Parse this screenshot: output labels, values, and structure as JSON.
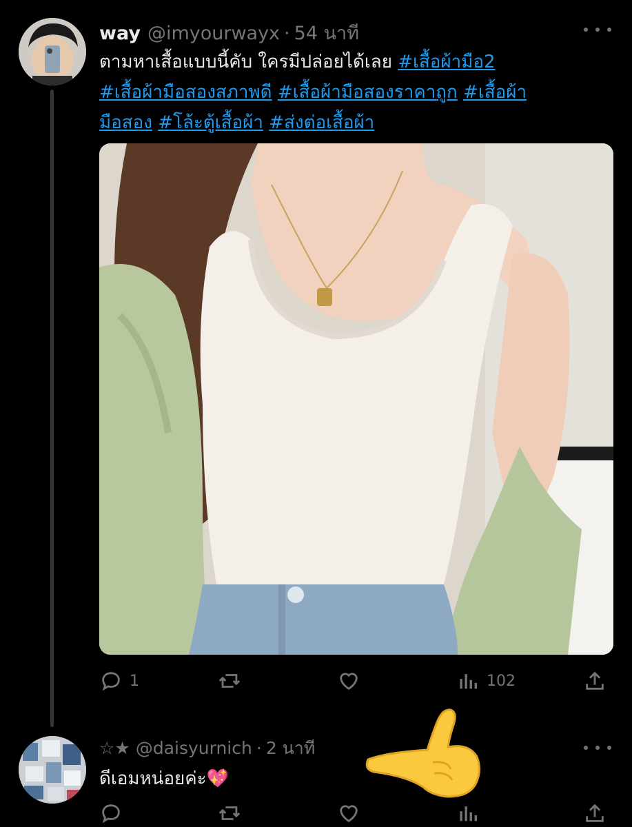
{
  "post": {
    "display_name": "way",
    "handle": "@imyourwayx",
    "time": "54 นาที",
    "text": "ตามหาเสื้อแบบนี้คับ ใครมีปล่อยได้เลย",
    "hashtags": [
      "#เสื้อผ้ามือ2",
      "#เสื้อผ้ามือสองสภาพดี",
      "#เสื้อผ้ามือสองราคาถูก",
      "#เสื้อผ้ามือสอง",
      "#โล้ะตู้เสื้อผ้า",
      "#ส่งต่อเสื้อผ้า"
    ],
    "hashtag_line_parts": {
      "line1_tag": "#เสื้อผ้ามือ2",
      "line2_tag1": "#เสื้อผ้ามือสองสภาพดี",
      "line2_tag2": "#เสื้อผ้ามือสองราคาถูก",
      "line2_tag3_start": "#เสื้อผ้า",
      "line3_tag3_end": "มือสอง",
      "line3_tag4": "#โล้ะตู้เสื้อผ้า",
      "line3_tag5": "#ส่งต่อเสื้อผ้า"
    },
    "reply_count": "1",
    "view_count": "102"
  },
  "reply": {
    "display_name": "☆★",
    "handle": "@daisyurnich",
    "time": "2 นาที",
    "text": "ดีเอมหน่อยค่ะ💖"
  },
  "icons": {
    "reply": "reply-icon",
    "retweet": "retweet-icon",
    "like": "heart-icon",
    "views": "views-icon",
    "share": "share-icon",
    "more": "more-icon"
  },
  "colors": {
    "background": "#000000",
    "text": "#e7e9ea",
    "muted": "#71767b",
    "link": "#1d9bf0"
  }
}
